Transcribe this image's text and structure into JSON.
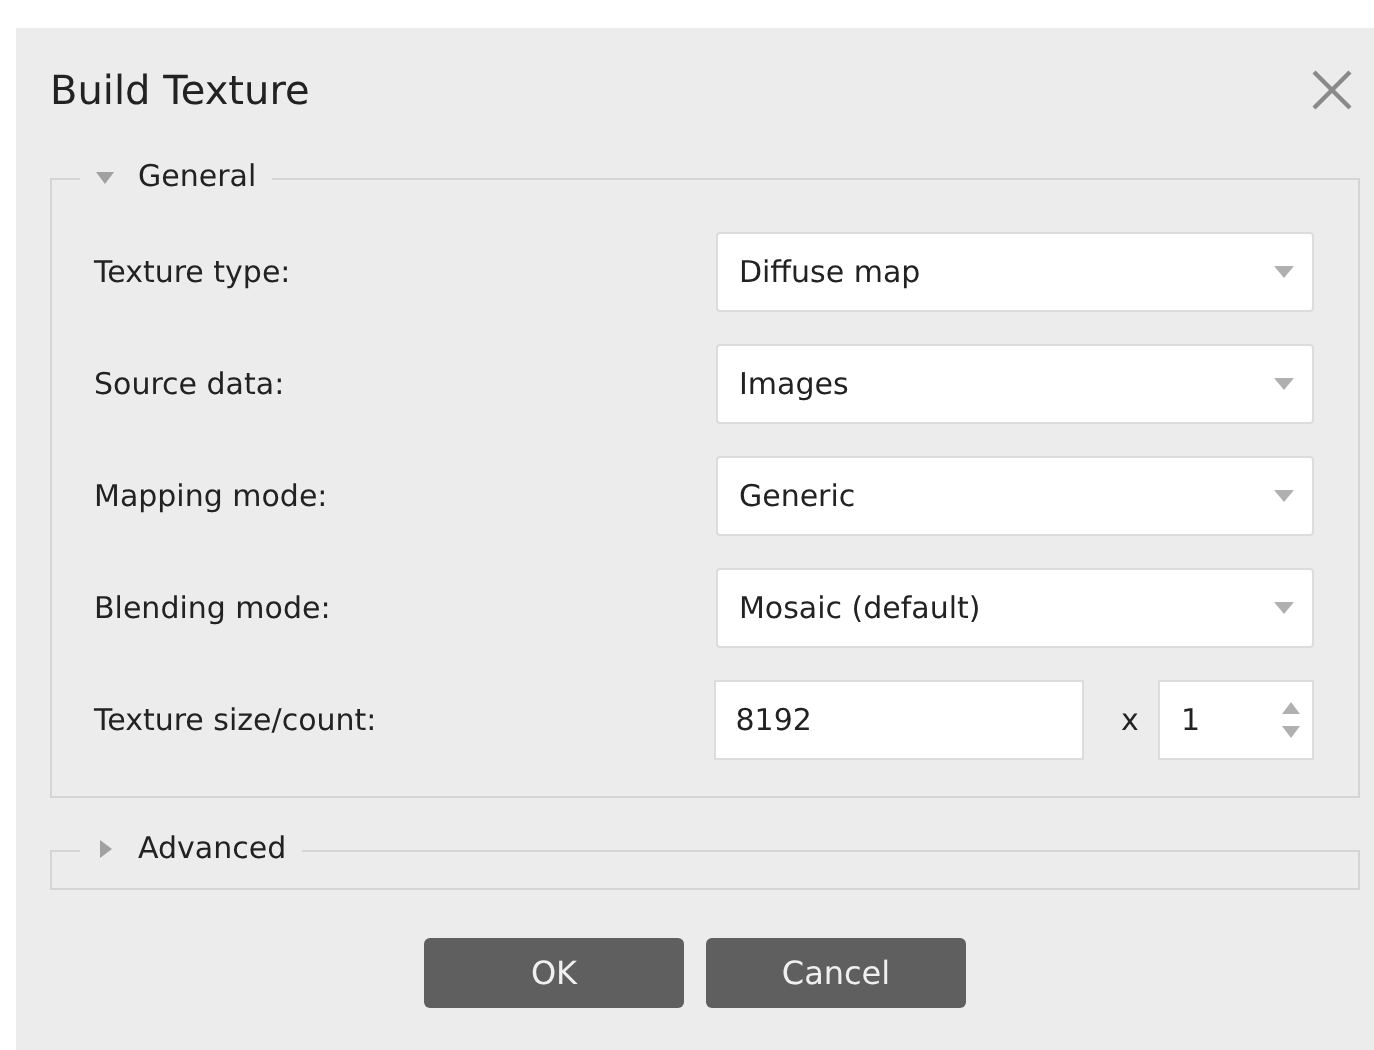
{
  "window": {
    "title": "Build Texture"
  },
  "sections": [
    {
      "title": "General",
      "expanded": true,
      "fields": [
        {
          "kind": "combo",
          "label": "Texture type:",
          "value": "Diffuse map"
        },
        {
          "kind": "combo",
          "label": "Source data:",
          "value": "Images"
        },
        {
          "kind": "combo",
          "label": "Mapping mode:",
          "value": "Generic"
        },
        {
          "kind": "combo",
          "label": "Blending mode:",
          "value": "Mosaic (default)"
        },
        {
          "kind": "size",
          "label": "Texture size/count:",
          "value": "8192",
          "separator": "x",
          "count": "1"
        }
      ]
    },
    {
      "title": "Advanced",
      "expanded": false
    }
  ],
  "buttons": [
    "OK",
    "Cancel"
  ]
}
